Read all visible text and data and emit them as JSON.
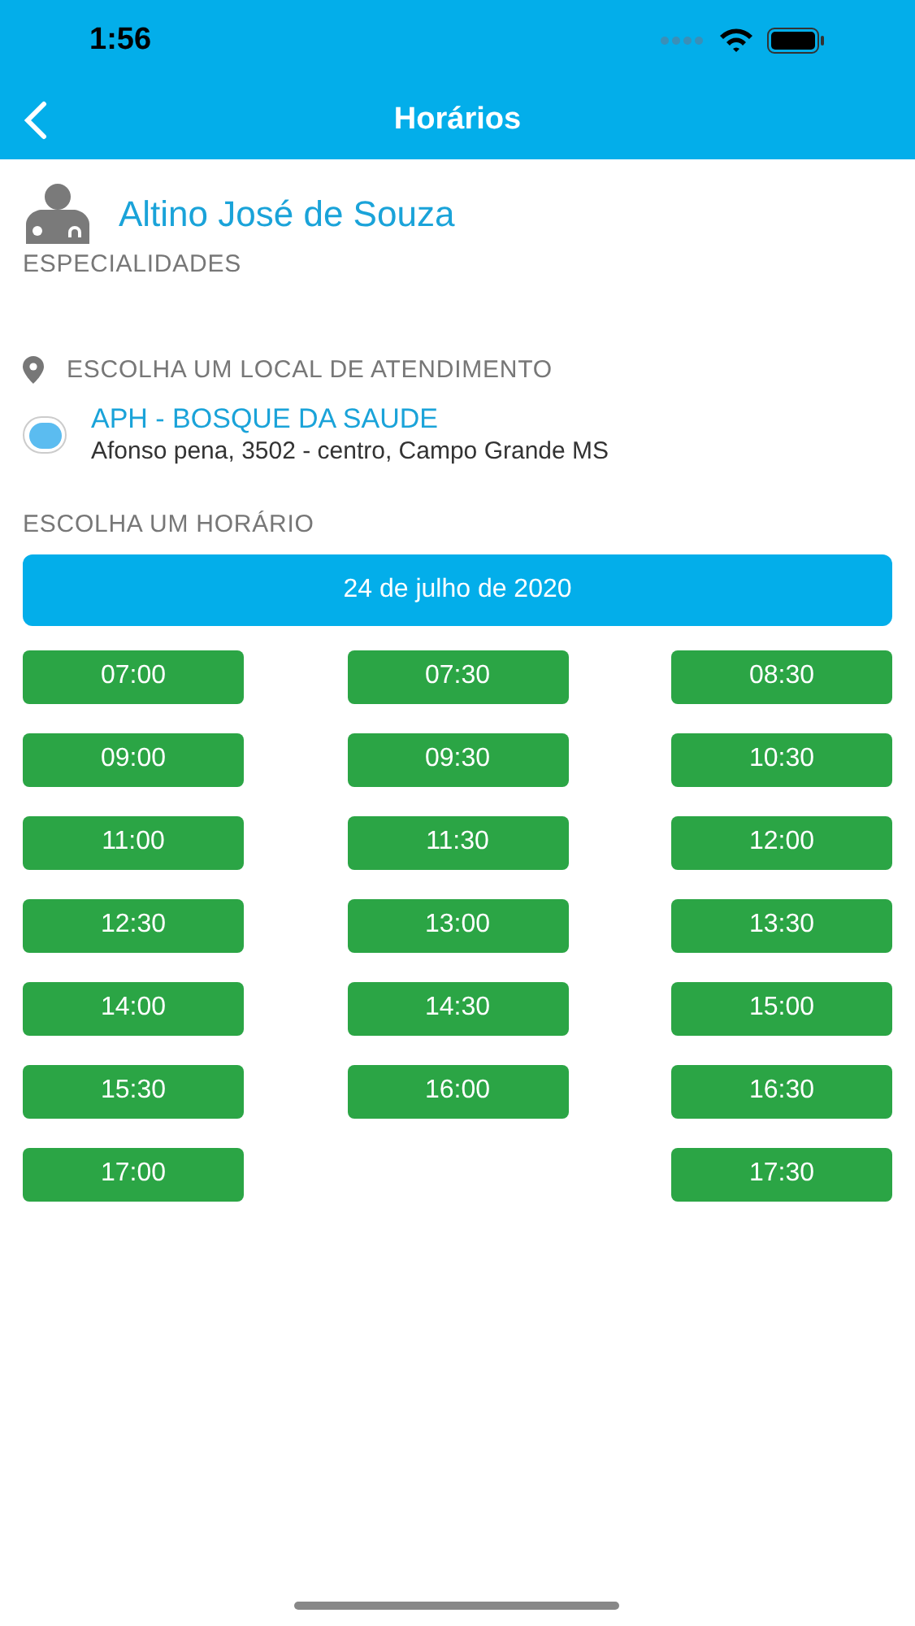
{
  "status_bar": {
    "time": "1:56"
  },
  "nav": {
    "title": "Horários"
  },
  "doctor": {
    "name": "Altino José de Souza",
    "subtitle": "ESPECIALIDADES"
  },
  "location_section": {
    "heading": "ESCOLHA UM LOCAL DE ATENDIMENTO",
    "options": [
      {
        "name": "APH - BOSQUE DA SAUDE",
        "address": "Afonso pena, 3502 - centro, Campo Grande MS",
        "selected": true
      }
    ]
  },
  "schedule": {
    "heading": "ESCOLHA UM HORÁRIO",
    "date": "24 de julho de 2020",
    "rows": [
      {
        "left": "07:00",
        "center": "07:30",
        "right": "08:30"
      },
      {
        "left": "09:00",
        "center": "09:30",
        "right": "10:30"
      },
      {
        "left": "11:00",
        "center": "11:30",
        "right": "12:00"
      },
      {
        "left": "12:30",
        "center": "13:00",
        "right": "13:30"
      },
      {
        "left": "14:00",
        "center": "14:30",
        "right": "15:00"
      },
      {
        "left": "15:30",
        "center": "16:00",
        "right": "16:30"
      },
      {
        "left": "17:00",
        "right": "17:30"
      }
    ]
  }
}
